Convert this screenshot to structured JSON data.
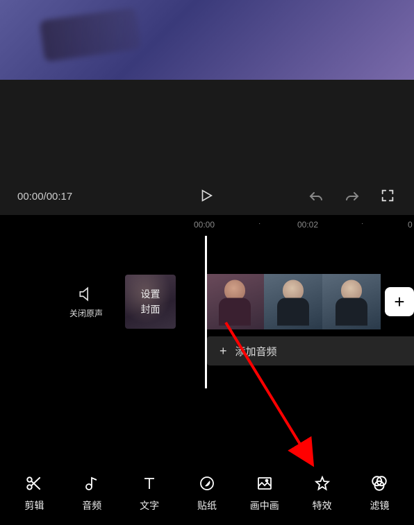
{
  "player": {
    "current_time": "00:00",
    "total_time": "00:17",
    "time_display": "00:00/00:17"
  },
  "ruler": {
    "marks": [
      {
        "label": "00:00",
        "pos": 279
      },
      {
        "label": "00:02",
        "pos": 428
      },
      {
        "label": "0",
        "pos": 587
      }
    ],
    "dots": [
      {
        "pos": 372
      },
      {
        "pos": 520
      }
    ]
  },
  "timeline": {
    "mute_label": "关闭原声",
    "cover_line1": "设置",
    "cover_line2": "封面",
    "add_clip_label": "+",
    "audio_plus": "+",
    "audio_label": "添加音频"
  },
  "toolbar": {
    "items": [
      {
        "id": "edit",
        "label": "剪辑",
        "icon": "scissors"
      },
      {
        "id": "audio",
        "label": "音频",
        "icon": "note"
      },
      {
        "id": "text",
        "label": "文字",
        "icon": "text"
      },
      {
        "id": "sticker",
        "label": "贴纸",
        "icon": "moon"
      },
      {
        "id": "pip",
        "label": "画中画",
        "icon": "image"
      },
      {
        "id": "effect",
        "label": "特效",
        "icon": "star"
      },
      {
        "id": "filter",
        "label": "滤镜",
        "icon": "rings"
      }
    ]
  }
}
